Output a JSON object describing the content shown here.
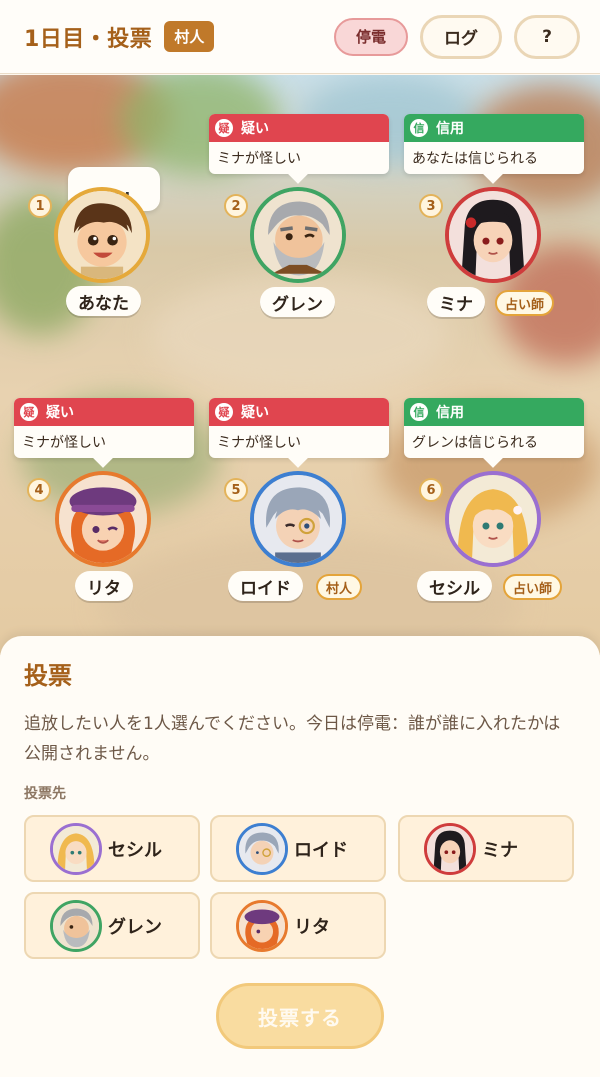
{
  "header": {
    "title": "1日目・投票",
    "role_badge": "村人",
    "outage_label": "停電",
    "log_label": "ログ",
    "help_label": "?"
  },
  "players": [
    {
      "seat": "1",
      "name": "あなた",
      "ring": "#e5a93a",
      "thought": "……",
      "role_tag": ""
    },
    {
      "seat": "2",
      "name": "グレン",
      "ring": "#3fa463",
      "bubble_head": "疑い",
      "bubble_icon": "疑",
      "bubble_text": "ミナが怪しい",
      "role_tag": ""
    },
    {
      "seat": "3",
      "name": "ミナ",
      "ring": "#cf3c3c",
      "bubble_head": "信用",
      "bubble_icon": "信",
      "bubble_text": "あなたは信じられる",
      "role_tag": "占い師"
    },
    {
      "seat": "4",
      "name": "リタ",
      "ring": "#e77a2e",
      "bubble_head": "疑い",
      "bubble_icon": "疑",
      "bubble_text": "ミナが怪しい",
      "role_tag": ""
    },
    {
      "seat": "5",
      "name": "ロイド",
      "ring": "#3d7fd1",
      "bubble_head": "疑い",
      "bubble_icon": "疑",
      "bubble_text": "ミナが怪しい",
      "role_tag": "村人"
    },
    {
      "seat": "6",
      "name": "セシル",
      "ring": "#9a6fd1",
      "bubble_head": "信用",
      "bubble_icon": "信",
      "bubble_text": "グレンは信じられる",
      "role_tag": "占い師"
    }
  ],
  "vote_panel": {
    "title": "投票",
    "description": "追放したい人を1人選んでください。今日は停電：誰が誰に入れたかは公開されません。",
    "targets_label": "投票先",
    "options": [
      {
        "name": "セシル",
        "ring": "#9a6fd1"
      },
      {
        "name": "ロイド",
        "ring": "#3d7fd1"
      },
      {
        "name": "ミナ",
        "ring": "#cf3c3c"
      },
      {
        "name": "グレン",
        "ring": "#3fa463"
      },
      {
        "name": "リタ",
        "ring": "#e77a2e"
      }
    ],
    "submit_label": "投票する"
  },
  "colors": {
    "accent": "#a5601a",
    "doubt": "#e0454f",
    "trust": "#35a95f",
    "button_disabled": "#f9dca0"
  }
}
